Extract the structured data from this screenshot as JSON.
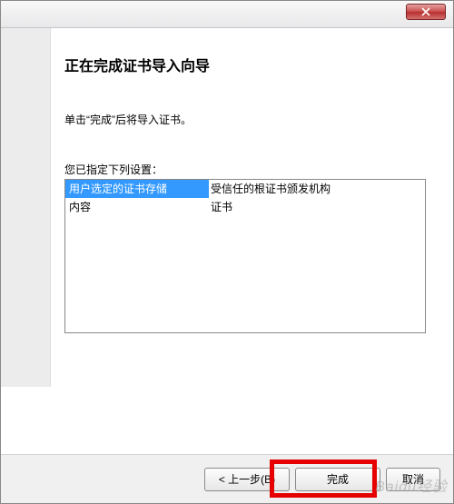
{
  "titlebar": {
    "close_aria": "Close"
  },
  "wizard": {
    "heading": "正在完成证书导入向导",
    "instruction": "单击“完成”后将导入证书。",
    "settings_caption": "您已指定下列设置：",
    "rows": [
      {
        "key": "用户选定的证书存储",
        "value": "受信任的根证书颁发机构"
      },
      {
        "key": "内容",
        "value": "证书"
      }
    ]
  },
  "buttons": {
    "back": "< 上一步(B)",
    "finish": "完成",
    "cancel": "取消"
  },
  "watermark": "Baidu经验"
}
